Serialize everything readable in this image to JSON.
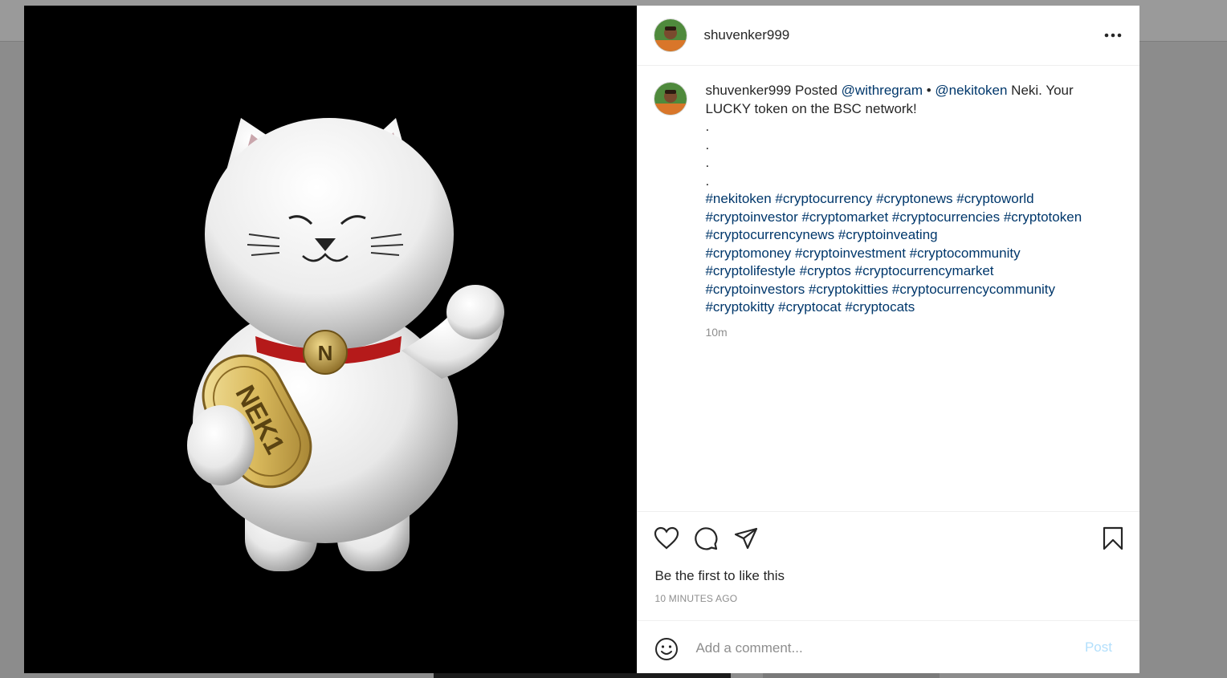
{
  "post": {
    "username": "shuvenker999"
  },
  "caption": {
    "username": "shuvenker999",
    "posted_word": "Posted",
    "mention_1": "@withregram",
    "bullet": " • ",
    "mention_2": "@nekitoken",
    "text": " Neki. Your LUCKY token on the BSC network!",
    "dots": [
      ".",
      ".",
      ".",
      "."
    ],
    "hashtags": [
      "#nekitoken",
      "#cryptocurrency",
      "#cryptonews",
      "#cryptoworld",
      "#cryptoinvestor",
      "#cryptomarket",
      "#cryptocurrencies",
      "#cryptotoken",
      "#cryptocurrencynews",
      "#cryptoinveating",
      "#cryptomoney",
      "#cryptoinvestment",
      "#cryptocommunity",
      "#cryptolifestyle",
      "#cryptos",
      "#cryptocurrencymarket",
      "#cryptoinvestors",
      "#cryptokitties",
      "#cryptocurrencycommunity",
      "#cryptokitty",
      "#cryptocat",
      "#cryptocats"
    ],
    "age": "10m"
  },
  "media": {
    "coin_text": "NEK1",
    "medallion_letter": "N"
  },
  "likes": {
    "prefix": "Be the first to ",
    "action": "like this"
  },
  "post_time": "10 MINUTES AGO",
  "comment_box": {
    "placeholder": "Add a comment...",
    "post_label": "Post"
  },
  "icons": {
    "more": "more-options-icon",
    "like": "heart-icon",
    "comment": "comment-bubble-icon",
    "share": "paper-plane-icon",
    "save": "bookmark-icon",
    "emoji": "emoji-icon"
  },
  "colors": {
    "link": "#00376b",
    "muted": "#8e8e8e",
    "post_disabled": "#b2dffc"
  }
}
